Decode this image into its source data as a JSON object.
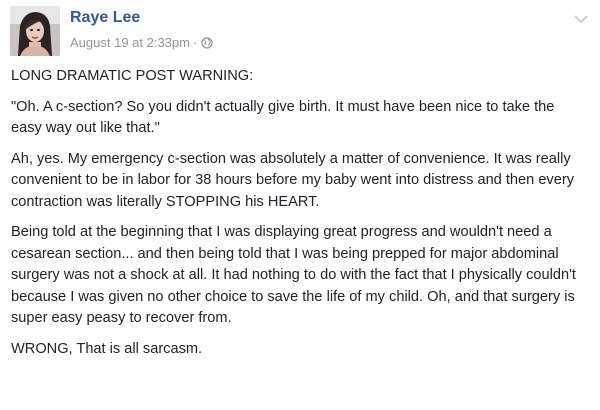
{
  "post": {
    "author": "Raye Lee",
    "timestamp": "August 19 at 2:33pm",
    "separator": "·",
    "privacy_icon": "globe-icon",
    "menu_icon": "chevron-down-icon",
    "paragraphs": [
      "LONG DRAMATIC POST WARNING:",
      "\"Oh. A c-section? So you didn't actually give birth. It must have been nice to take the easy way out like that.\"",
      "Ah, yes. My emergency c-section was absolutely a matter of convenience. It was really convenient to be in labor for 38 hours before my baby went into distress and then every contraction was literally STOPPING his HEART.",
      "Being told at the beginning that I was displaying great progress and wouldn't need a cesarean section... and then being told that I was being prepped for major abdominal surgery was not a shock at all. It had nothing to do with the fact that I physically couldn't because I was given no other choice to save the life of my child. Oh, and that surgery is super easy peasy to recover from.",
      "WRONG, That is all sarcasm."
    ]
  },
  "colors": {
    "author_link": "#365899",
    "meta_text": "#90949c",
    "body_text": "#1d2129"
  }
}
